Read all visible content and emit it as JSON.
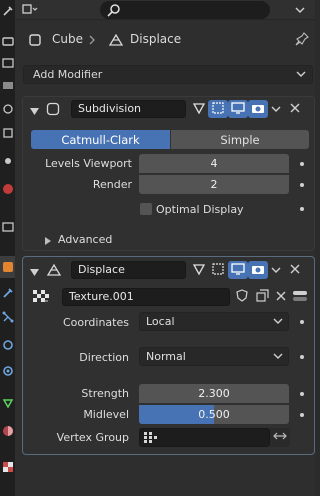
{
  "colors": {
    "accent": "#4772b3",
    "panel": "#303030",
    "field": "#545454",
    "dark_field": "#1d1d1d"
  },
  "tabs": [
    {
      "icon": "tool-icon"
    },
    {
      "icon": "render-icon"
    },
    {
      "icon": "output-icon"
    },
    {
      "icon": "view-layer-icon"
    },
    {
      "icon": "scene-icon"
    },
    {
      "icon": "world-icon"
    },
    {
      "icon": "collection-icon"
    },
    {
      "icon": "texture-icon"
    },
    {
      "icon": "object-icon"
    },
    {
      "icon": "modifier-icon",
      "active": true
    },
    {
      "icon": "particles-icon"
    },
    {
      "icon": "physics-icon"
    },
    {
      "icon": "constraints-icon"
    },
    {
      "icon": "object-data-icon"
    },
    {
      "icon": "material-icon"
    },
    {
      "icon": "texture-checker-icon"
    }
  ],
  "breadcrumb": {
    "object": "Cube",
    "modifier": "Displace"
  },
  "add_modifier_label": "Add Modifier",
  "subdivision": {
    "name": "Subdivision",
    "algorithm_options": [
      "Catmull-Clark",
      "Simple"
    ],
    "selected_algorithm": "Catmull-Clark",
    "levels_viewport_label": "Levels Viewport",
    "levels_viewport": "4",
    "render_label": "Render",
    "render": "2",
    "optimal_display_label": "Optimal Display",
    "optimal_display_checked": false,
    "advanced_label": "Advanced"
  },
  "displace": {
    "name": "Displace",
    "texture": "Texture.001",
    "coordinates_label": "Coordinates",
    "coordinates": "Local",
    "direction_label": "Direction",
    "direction": "Normal",
    "strength_label": "Strength",
    "strength": "2.300",
    "midlevel_label": "Midlevel",
    "midlevel": "0.500",
    "midlevel_fraction": 0.5,
    "vertex_group_label": "Vertex Group",
    "vertex_group": ""
  }
}
